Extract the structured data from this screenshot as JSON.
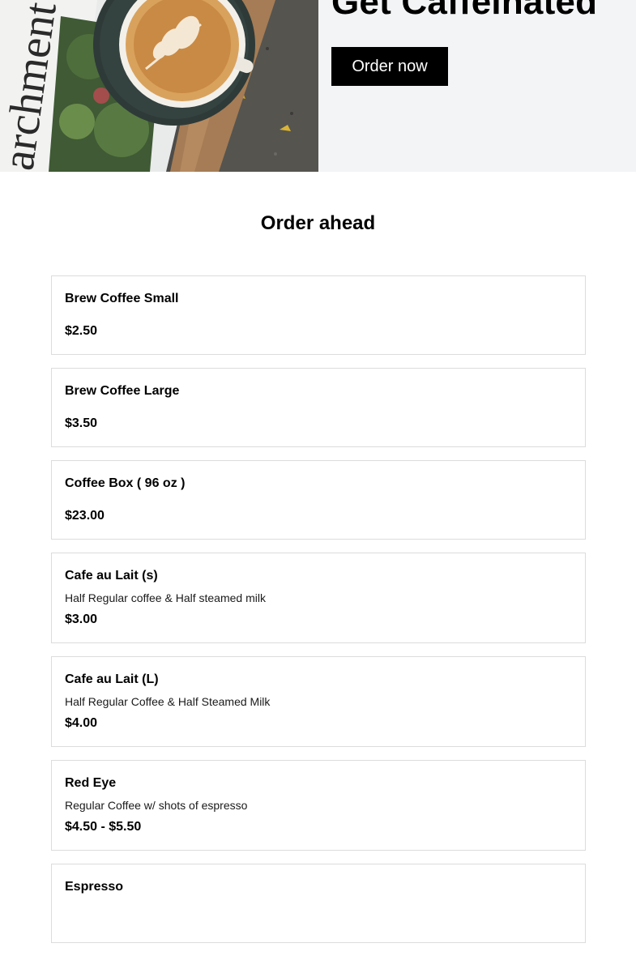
{
  "hero": {
    "title": "Get Caffeinated",
    "order_button": "Order now",
    "image_icon": "coffee-cup-image",
    "newspaper_text": "archment"
  },
  "section": {
    "title": "Order ahead"
  },
  "menu": {
    "items": [
      {
        "name": "Brew Coffee Small",
        "description": "",
        "price": "$2.50"
      },
      {
        "name": "Brew Coffee Large",
        "description": "",
        "price": "$3.50"
      },
      {
        "name": "Coffee Box ( 96 oz )",
        "description": "",
        "price": "$23.00"
      },
      {
        "name": "Cafe au Lait (s)",
        "description": "Half Regular coffee & Half steamed milk",
        "price": "$3.00"
      },
      {
        "name": "Cafe au Lait (L)",
        "description": "Half Regular Coffee & Half Steamed Milk",
        "price": "$4.00"
      },
      {
        "name": "Red Eye",
        "description": "Regular Coffee w/ shots of espresso",
        "price": "$4.50 - $5.50"
      },
      {
        "name": "Espresso",
        "description": "",
        "price": ""
      }
    ]
  },
  "colors": {
    "hero_panel_bg": "#f3f4f6",
    "button_bg": "#000000",
    "button_text": "#ffffff",
    "card_border": "#dcdcdc"
  }
}
